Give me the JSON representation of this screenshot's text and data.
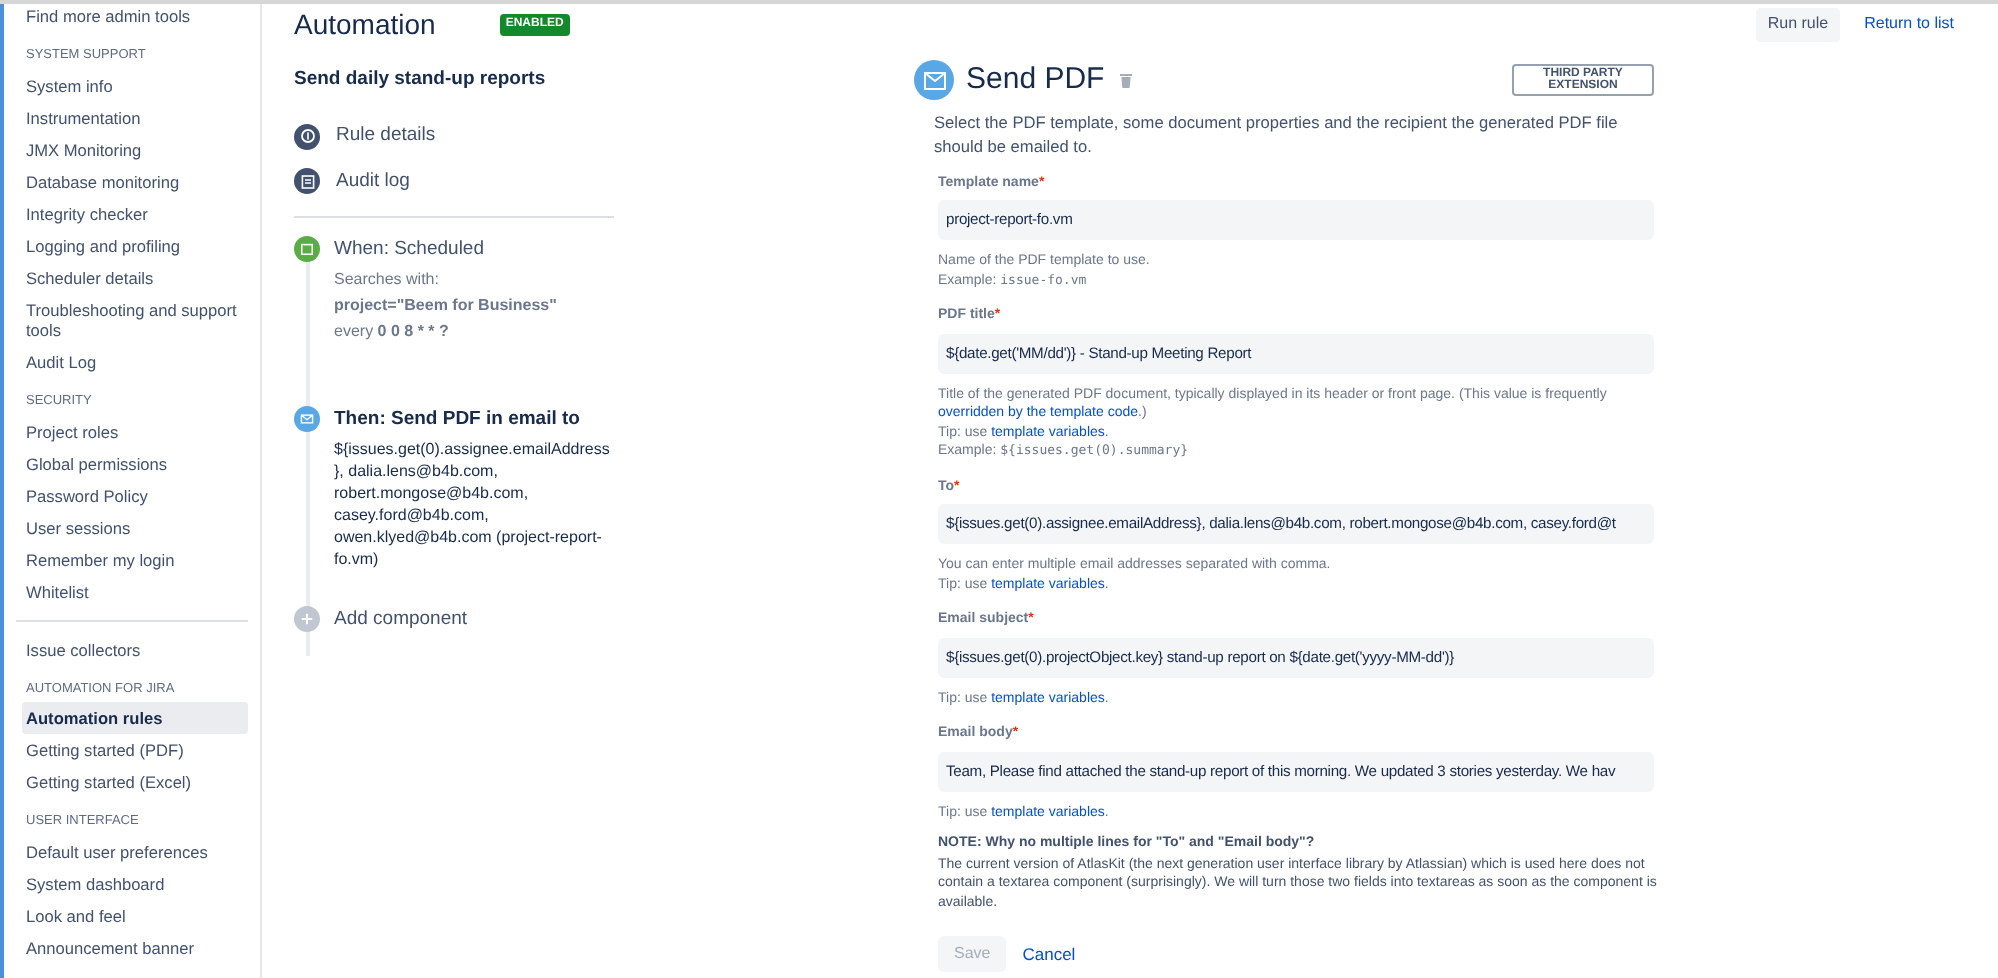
{
  "sidebar": {
    "groups": [
      {
        "items": [
          {
            "label": "Find more admin tools",
            "selected": false
          }
        ]
      },
      {
        "heading": "SYSTEM SUPPORT",
        "items": [
          {
            "label": "System info",
            "selected": false
          },
          {
            "label": "Instrumentation",
            "selected": false
          },
          {
            "label": "JMX Monitoring",
            "selected": false
          },
          {
            "label": "Database monitoring",
            "selected": false
          },
          {
            "label": "Integrity checker",
            "selected": false
          },
          {
            "label": "Logging and profiling",
            "selected": false
          },
          {
            "label": "Scheduler details",
            "selected": false
          },
          {
            "label": "Troubleshooting and support tools",
            "selected": false
          },
          {
            "label": "Audit Log",
            "selected": false
          }
        ]
      },
      {
        "heading": "SECURITY",
        "items": [
          {
            "label": "Project roles",
            "selected": false
          },
          {
            "label": "Global permissions",
            "selected": false
          },
          {
            "label": "Password Policy",
            "selected": false
          },
          {
            "label": "User sessions",
            "selected": false
          },
          {
            "label": "Remember my login",
            "selected": false
          },
          {
            "label": "Whitelist",
            "selected": false
          }
        ]
      },
      {
        "divider_before": true,
        "items": [
          {
            "label": "Issue collectors",
            "selected": false
          }
        ]
      },
      {
        "heading": "AUTOMATION FOR JIRA",
        "items": [
          {
            "label": "Automation rules",
            "selected": true
          },
          {
            "label": "Getting started (PDF)",
            "selected": false
          },
          {
            "label": "Getting started (Excel)",
            "selected": false
          }
        ]
      },
      {
        "heading": "USER INTERFACE",
        "items": [
          {
            "label": "Default user preferences",
            "selected": false
          },
          {
            "label": "System dashboard",
            "selected": false
          },
          {
            "label": "Look and feel",
            "selected": false
          },
          {
            "label": "Announcement banner",
            "selected": false
          }
        ]
      }
    ]
  },
  "header": {
    "title": "Automation",
    "status": "ENABLED",
    "actions": [
      {
        "kind": "button",
        "label": "Run rule"
      },
      {
        "kind": "link",
        "label": "Return to list"
      }
    ]
  },
  "rule": {
    "name": "Send daily stand-up reports",
    "nav": [
      {
        "kind": "info",
        "label": "Rule details"
      },
      {
        "kind": "log",
        "label": "Audit log"
      }
    ],
    "components": [
      {
        "kind": "trigger",
        "title": "When: Scheduled",
        "lines": [
          "Searches with:",
          "**project=\"Beem for Business\"**",
          "every **0 0 8 * * ?**"
        ]
      },
      {
        "kind": "action",
        "title": "Then: Send PDF in email to",
        "lines": [
          "${issues.get(0).assignee.emailAddress}, dalia.lens@b4b.com, robert.mongose@b4b.com, casey.ford@b4b.com, owen.klyed@b4b.com (project-report-fo.vm)"
        ]
      },
      {
        "kind": "add",
        "title": "Add component"
      }
    ]
  },
  "panel": {
    "title": "Send PDF",
    "badge": "THIRD PARTY EXTENSION",
    "description": "Select the PDF template, some document properties and the recipient the generated PDF file should be emailed to.",
    "fields": [
      {
        "label": "Template name",
        "required": "*",
        "value": "project-report-fo.vm",
        "help": [
          [
            {
              "kind": "text",
              "text": "Name of the PDF template to use."
            }
          ],
          [
            {
              "kind": "text",
              "text": "Example: "
            },
            {
              "kind": "code",
              "text": "issue-fo.vm"
            }
          ]
        ]
      },
      {
        "label": "PDF title",
        "required": "*",
        "value": "${date.get('MM/dd')} - Stand-up Meeting Report",
        "help": [
          [
            {
              "kind": "text",
              "text": "Title of the generated PDF document, typically displayed in its header or front page. (This value is frequently "
            },
            {
              "kind": "link",
              "text": "overridden by the template code"
            },
            {
              "kind": "text",
              "text": ".)"
            }
          ],
          [
            {
              "kind": "text",
              "text": "Tip: use "
            },
            {
              "kind": "link",
              "text": "template variables"
            },
            {
              "kind": "text",
              "text": "."
            }
          ],
          [
            {
              "kind": "text",
              "text": "Example: "
            },
            {
              "kind": "code",
              "text": "${issues.get(0).summary}"
            }
          ]
        ]
      },
      {
        "label": "To",
        "required": "*",
        "value": "${issues.get(0).assignee.emailAddress}, dalia.lens@b4b.com, robert.mongose@b4b.com, casey.ford@t",
        "help": [
          [
            {
              "kind": "text",
              "text": "You can enter multiple email addresses separated with comma."
            }
          ],
          [
            {
              "kind": "text",
              "text": "Tip: use "
            },
            {
              "kind": "link",
              "text": "template variables"
            },
            {
              "kind": "text",
              "text": "."
            }
          ]
        ]
      },
      {
        "label": "Email subject",
        "required": "*",
        "value": "${issues.get(0).projectObject.key} stand-up report on ${date.get('yyyy-MM-dd')}",
        "help": [
          [
            {
              "kind": "text",
              "text": "Tip: use "
            },
            {
              "kind": "link",
              "text": "template variables"
            },
            {
              "kind": "text",
              "text": "."
            }
          ]
        ]
      },
      {
        "label": "Email body",
        "required": "*",
        "value": "Team, Please find attached the stand-up report of this morning. We updated 3 stories yesterday. We hav",
        "help": [
          [
            {
              "kind": "text",
              "text": "Tip: use "
            },
            {
              "kind": "link",
              "text": "template variables"
            },
            {
              "kind": "text",
              "text": "."
            }
          ]
        ]
      }
    ],
    "note": {
      "heading": "NOTE: Why no multiple lines for \"To\" and \"Email body\"?",
      "text": "The current version of AtlasKit (the next generation user interface library by Atlassian) which is used here does not contain a textarea component (surprisingly). We will turn those two fields into textareas as soon as the component is available."
    },
    "buttons": [
      {
        "kind": "button",
        "label": "Save",
        "disabled": true
      },
      {
        "kind": "link",
        "label": "Cancel",
        "disabled": false
      }
    ]
  }
}
